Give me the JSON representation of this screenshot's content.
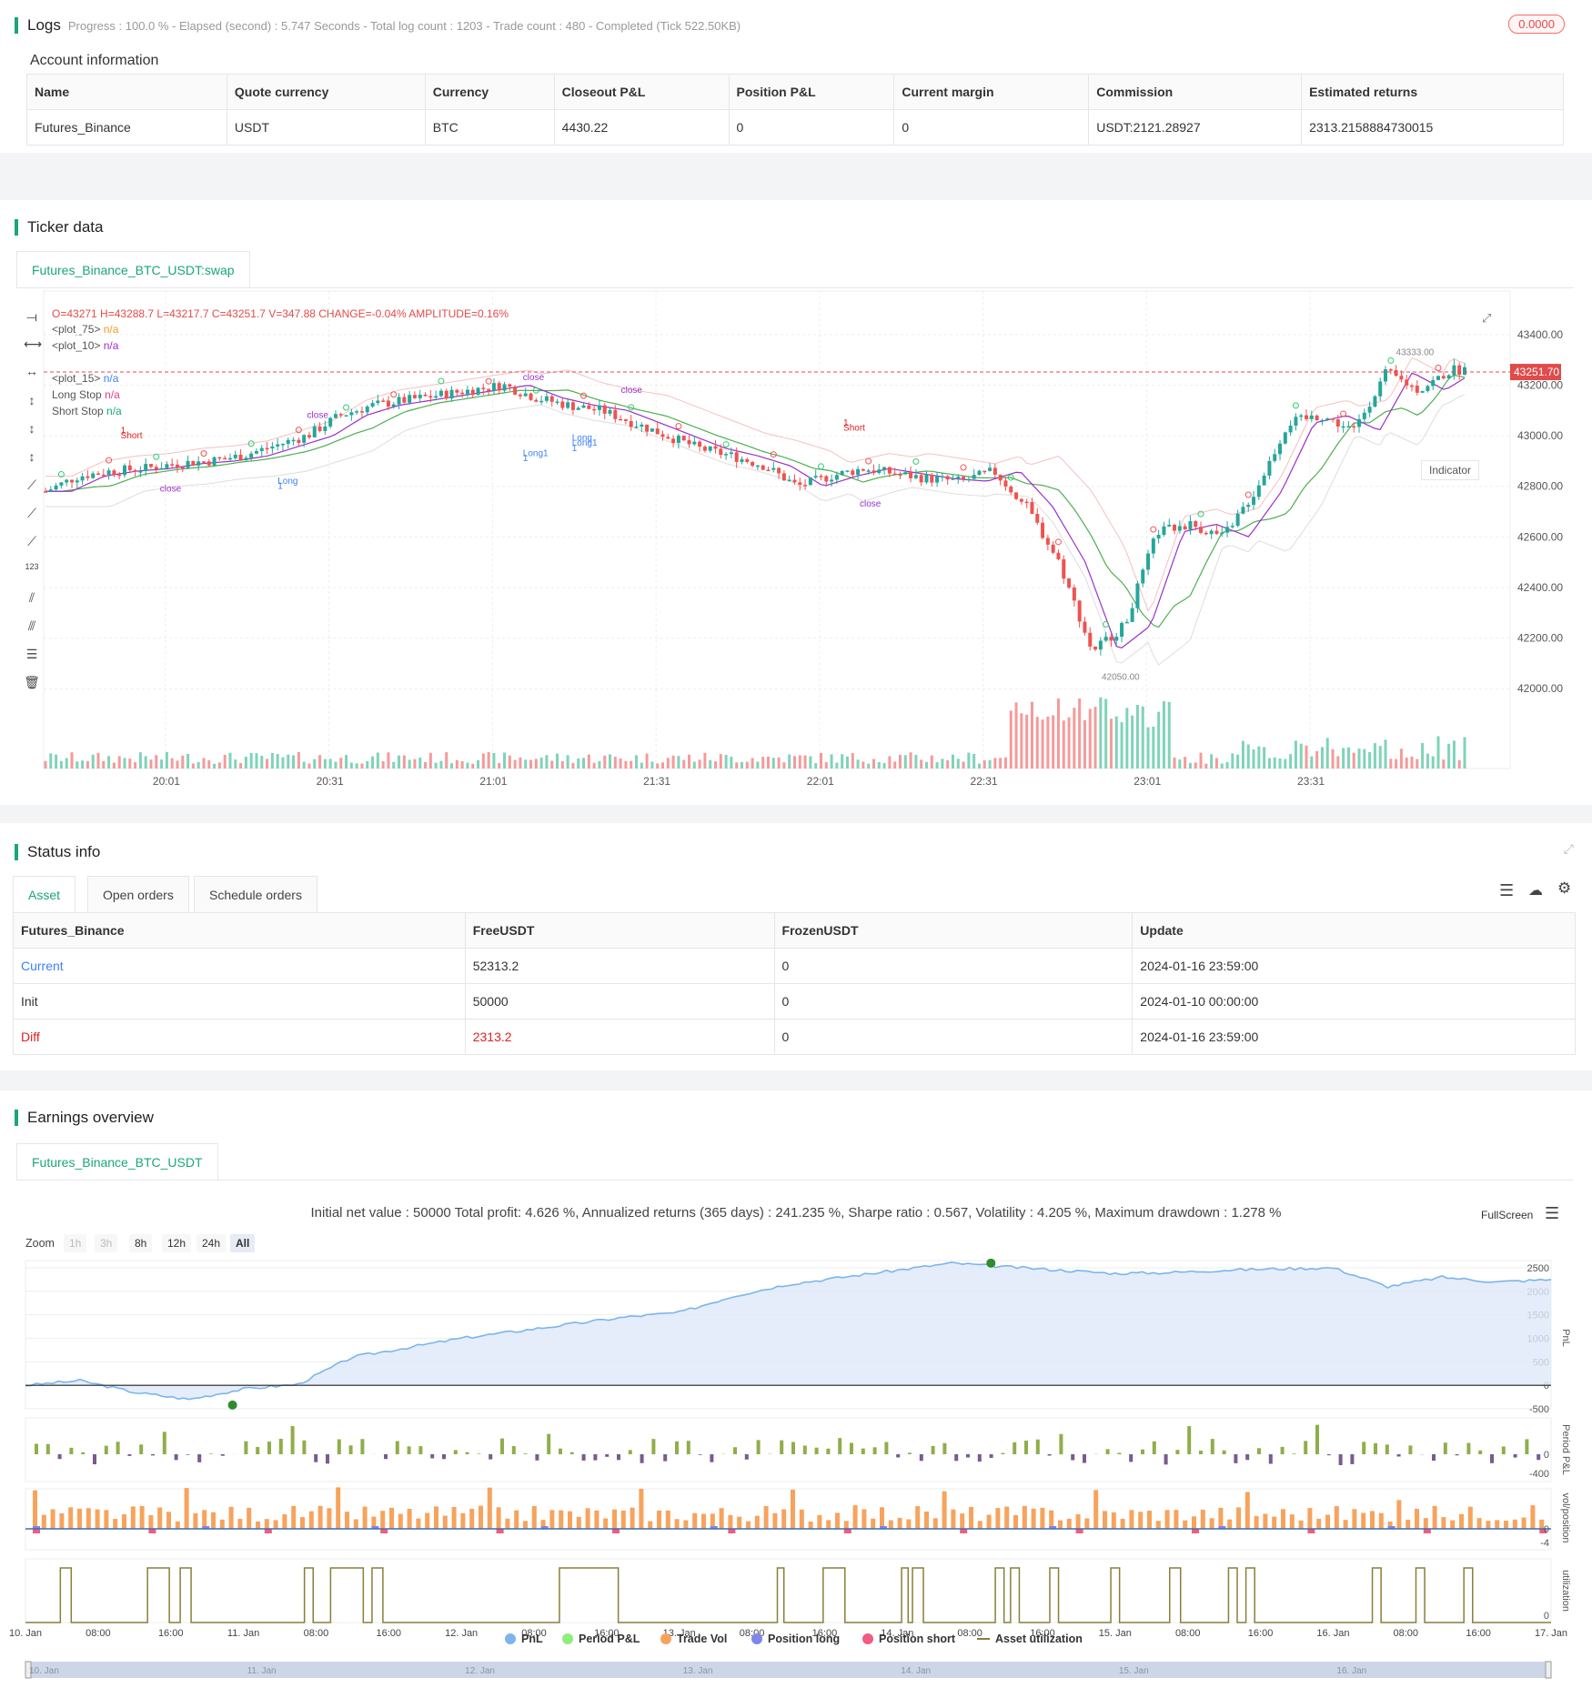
{
  "logs": {
    "title": "Logs",
    "status": "Progress : 100.0 % - Elapsed (second) : 5.747  Seconds - Total log count : 1203 - Trade count : 480 - Completed (Tick 522.50KB)",
    "badge": "0.0000"
  },
  "account": {
    "title": "Account information",
    "headers": [
      "Name",
      "Quote currency",
      "Currency",
      "Closeout P&L",
      "Position P&L",
      "Current margin",
      "Commission",
      "Estimated returns"
    ],
    "row": [
      "Futures_Binance",
      "USDT",
      "BTC",
      "4430.22",
      "0",
      "0",
      "USDT:2121.28927",
      "2313.2158884730015"
    ]
  },
  "ticker": {
    "title": "Ticker data",
    "tab": "Futures_Binance_BTC_USDT:swap",
    "ohlc": "O=43271 H=43288.7 L=43217.7 C=43251.7 V=347.88 CHANGE=-0.04% AMPLITUDE=0.16%",
    "legend": [
      {
        "label": "<plot_75>",
        "value": "n/a",
        "color": "#f59a23"
      },
      {
        "label": "<plot_10>",
        "value": "n/a",
        "color": "#9b30c8"
      },
      {
        "label": "<plot_15>",
        "value": "n/a",
        "color": "#3b82f6"
      },
      {
        "label": "Long Stop",
        "value": "n/a",
        "color": "#e0408a"
      },
      {
        "label": "Short Stop",
        "value": "n/a",
        "color": "#1aa67a"
      }
    ],
    "indicator_btn": "Indicator",
    "price_tag": "43251.70",
    "high_label": "43333.00",
    "low_label": "42050.00",
    "chart_data": {
      "type": "candlestick",
      "y_ticks": [
        "43400.00",
        "43200.00",
        "43000.00",
        "42800.00",
        "42600.00",
        "42400.00",
        "42200.00",
        "42000.00"
      ],
      "x_ticks": [
        "20:01",
        "20:31",
        "21:01",
        "21:31",
        "22:01",
        "22:31",
        "23:01",
        "23:31"
      ],
      "ylim": [
        41900,
        43500
      ],
      "close_path": [
        [
          19.65,
          42780
        ],
        [
          19.75,
          42840
        ],
        [
          19.85,
          42860
        ],
        [
          19.95,
          42870
        ],
        [
          20.05,
          42890
        ],
        [
          20.15,
          42900
        ],
        [
          20.25,
          42920
        ],
        [
          20.35,
          42960
        ],
        [
          20.45,
          43000
        ],
        [
          20.55,
          43080
        ],
        [
          20.65,
          43120
        ],
        [
          20.75,
          43140
        ],
        [
          20.85,
          43160
        ],
        [
          20.95,
          43180
        ],
        [
          21.05,
          43200
        ],
        [
          21.15,
          43150
        ],
        [
          21.25,
          43120
        ],
        [
          21.35,
          43100
        ],
        [
          21.45,
          43050
        ],
        [
          21.55,
          43000
        ],
        [
          21.65,
          42950
        ],
        [
          21.75,
          42920
        ],
        [
          21.85,
          42880
        ],
        [
          21.95,
          42800
        ],
        [
          22.05,
          42840
        ],
        [
          22.15,
          42870
        ],
        [
          22.25,
          42850
        ],
        [
          22.35,
          42830
        ],
        [
          22.45,
          42820
        ],
        [
          22.55,
          42860
        ],
        [
          22.65,
          42720
        ],
        [
          22.75,
          42500
        ],
        [
          22.85,
          42150
        ],
        [
          22.95,
          42250
        ],
        [
          23.05,
          42620
        ],
        [
          23.15,
          42650
        ],
        [
          23.25,
          42600
        ],
        [
          23.35,
          42780
        ],
        [
          23.45,
          43050
        ],
        [
          23.55,
          43080
        ],
        [
          23.65,
          43020
        ],
        [
          23.75,
          43250
        ],
        [
          23.85,
          43180
        ],
        [
          23.95,
          43260
        ]
      ],
      "trade_labels": [
        "1",
        "Short",
        "close",
        "Long",
        "1",
        "close",
        "Long1",
        "1",
        "close",
        "Long",
        "Long1",
        "1",
        "close",
        "1",
        "Short",
        "close"
      ]
    }
  },
  "status": {
    "title": "Status info",
    "tabs": [
      "Asset",
      "Open orders",
      "Schedule orders"
    ],
    "headers": [
      "Futures_Binance",
      "FreeUSDT",
      "FrozenUSDT",
      "Update"
    ],
    "rows": [
      [
        "Current",
        "52313.2",
        "0",
        "2024-01-16 23:59:00"
      ],
      [
        "Init",
        "50000",
        "0",
        "2024-01-10 00:00:00"
      ],
      [
        "Diff",
        "2313.2",
        "0",
        "2024-01-16 23:59:00"
      ]
    ]
  },
  "earnings": {
    "title": "Earnings overview",
    "tab": "Futures_Binance_BTC_USDT",
    "summary": "Initial net value : 50000 Total profit: 4.626 %, Annualized returns (365 days) : 241.235 %, Sharpe ratio : 0.567, Volatility : 4.205 %, Maximum drawdown : 1.278 %",
    "fullscreen": "FullScreen",
    "zoom_label": "Zoom",
    "zoom_options": [
      "1h",
      "3h",
      "8h",
      "12h",
      "24h",
      "All"
    ],
    "pnl_axis": [
      "2500",
      "2000",
      "1500",
      "1000",
      "500",
      "0",
      "-500"
    ],
    "period_axis": [
      "0",
      "-400"
    ],
    "vol_axis": [
      "0",
      "-4"
    ],
    "util_axis": [
      "0"
    ],
    "axis_titles": [
      "PnL",
      "Period P&L",
      "vol/position",
      "utilization"
    ],
    "x_ticks": [
      "10. Jan",
      "08:00",
      "16:00",
      "11. Jan",
      "08:00",
      "16:00",
      "12. Jan",
      "08:00",
      "16:00",
      "13. Jan",
      "08:00",
      "16:00",
      "14. Jan",
      "08:00",
      "16:00",
      "15. Jan",
      "08:00",
      "16:00",
      "16. Jan",
      "08:00",
      "16:00",
      "17. Jan"
    ],
    "nav_ticks": [
      "10. Jan",
      "11. Jan",
      "12. Jan",
      "13. Jan",
      "14. Jan",
      "15. Jan",
      "16. Jan"
    ],
    "legend": [
      {
        "label": "PnL",
        "color": "#7cb5ec"
      },
      {
        "label": "Period P&L",
        "color": "#90ed7d"
      },
      {
        "label": "Trade Vol",
        "color": "#f7a35c"
      },
      {
        "label": "Position long",
        "color": "#8085e9"
      },
      {
        "label": "Position short",
        "color": "#f15c80"
      },
      {
        "label": "Asset utilization",
        "color": "#8b7d3a"
      }
    ],
    "chart_data": {
      "type": "area",
      "x_days": [
        0,
        0.25,
        0.5,
        0.75,
        1,
        1.25,
        1.5,
        1.75,
        2,
        2.25,
        2.5,
        2.75,
        3,
        3.25,
        3.5,
        3.75,
        4,
        4.25,
        4.5,
        4.75,
        5,
        5.25,
        5.5,
        5.75,
        6,
        6.25,
        6.5,
        6.75,
        7
      ],
      "pnl": [
        0,
        100,
        -150,
        -300,
        -80,
        20,
        600,
        800,
        1000,
        1150,
        1300,
        1450,
        1550,
        1900,
        2150,
        2300,
        2450,
        2600,
        2520,
        2450,
        2380,
        2400,
        2450,
        2480,
        2500,
        2100,
        2300,
        2200,
        2250
      ]
    }
  }
}
